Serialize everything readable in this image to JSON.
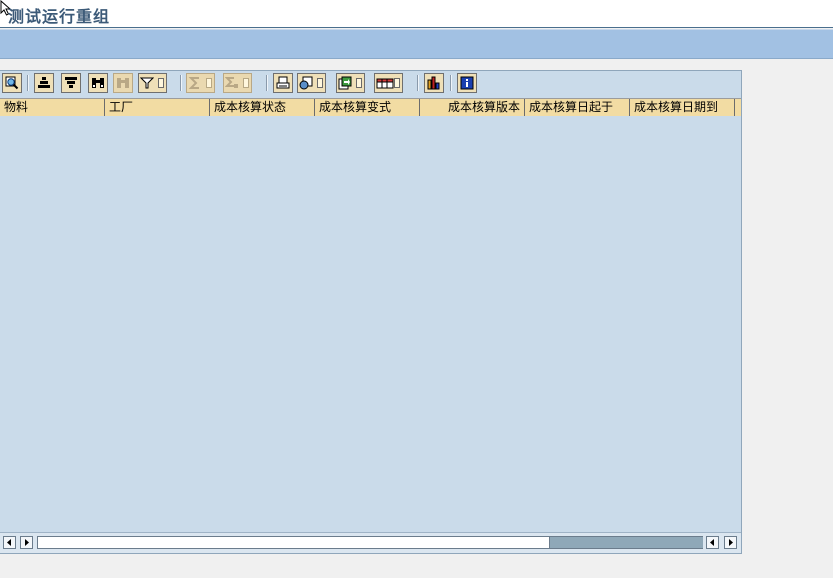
{
  "window": {
    "title": "测试运行重组"
  },
  "toolbar": {
    "buttons": [
      {
        "name": "details-button",
        "icon": "magnifier-details-icon",
        "enabled": true
      },
      {
        "name": "sort-ascending-button",
        "icon": "sort-ascending-icon",
        "enabled": true
      },
      {
        "name": "sort-descending-button",
        "icon": "sort-descending-icon",
        "enabled": true
      },
      {
        "name": "find-button",
        "icon": "binoculars-icon",
        "enabled": true
      },
      {
        "name": "find-next-button",
        "icon": "binoculars-next-icon",
        "enabled": false
      },
      {
        "name": "filter-button",
        "icon": "filter-icon",
        "enabled": true
      },
      {
        "name": "total-button",
        "icon": "sum-icon",
        "enabled": false
      },
      {
        "name": "subtotal-button",
        "icon": "subtotal-icon",
        "enabled": false
      },
      {
        "name": "print-preview-button",
        "icon": "print-preview-icon",
        "enabled": true
      },
      {
        "name": "views-button",
        "icon": "views-icon",
        "enabled": true
      },
      {
        "name": "export-button",
        "icon": "export-icon",
        "enabled": true
      },
      {
        "name": "layout-button",
        "icon": "layout-grid-icon",
        "enabled": true
      },
      {
        "name": "graphic-button",
        "icon": "bar-chart-icon",
        "enabled": true
      },
      {
        "name": "info-button",
        "icon": "info-icon",
        "enabled": true
      }
    ]
  },
  "grid": {
    "columns": [
      {
        "label": "物料",
        "align": "left"
      },
      {
        "label": "工厂",
        "align": "left"
      },
      {
        "label": "成本核算状态",
        "align": "left"
      },
      {
        "label": "成本核算变式",
        "align": "left"
      },
      {
        "label": "成本核算版本",
        "align": "right"
      },
      {
        "label": "成本核算日起于",
        "align": "left"
      },
      {
        "label": "成本核算日期到",
        "align": "left"
      }
    ],
    "rows": []
  },
  "scrollbar": {
    "position_fraction": 0.77,
    "visible_fraction": 0.23
  },
  "colors": {
    "accent_band": "#a2c1e3",
    "grid_background": "#cadbea",
    "header_background": "#f2dca3",
    "title_color": "#3c5a78"
  }
}
